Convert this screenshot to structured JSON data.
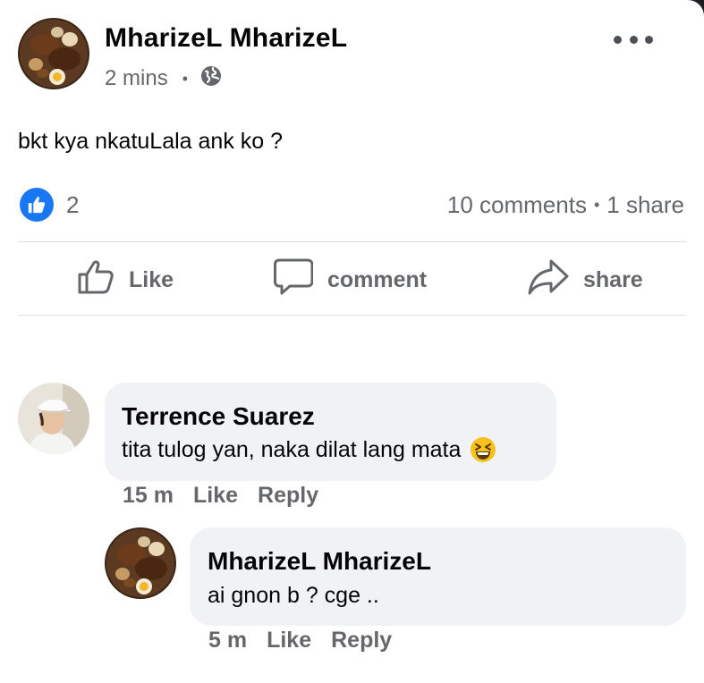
{
  "post": {
    "author": "MharizeL MharizeL",
    "time": "2 mins",
    "separator": "•",
    "privacy_icon": "globe-icon",
    "text": "bkt kya nkatuLala ank ko ?",
    "reactions": {
      "icon": "like-reaction-icon",
      "count": "2"
    },
    "stats": {
      "comments": "10 comments",
      "separator": "•",
      "shares": "1 share"
    }
  },
  "actions": {
    "like": "Like",
    "comment": "comment",
    "share": "share"
  },
  "comments": [
    {
      "author": "Terrence Suarez",
      "text": "tita tulog yan, naka dilat lang mata",
      "emoji": "laughing-squinting-emoji",
      "time": "15 m",
      "like": "Like",
      "reply": "Reply"
    },
    {
      "author": "MharizeL MharizeL",
      "text": "ai gnon b ? cge ..",
      "time": "5 m",
      "like": "Like",
      "reply": "Reply"
    }
  ],
  "colors": {
    "accent": "#1877f2",
    "secondary_text": "#65676b",
    "bubble": "#f0f2f5"
  }
}
